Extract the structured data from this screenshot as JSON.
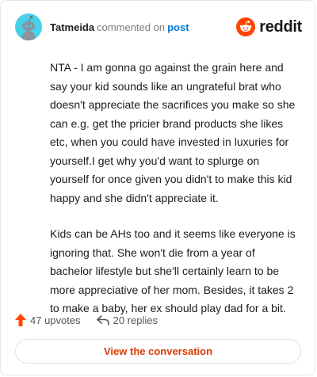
{
  "header": {
    "username": "Tatmeida",
    "action_text": "commented on",
    "target_text": "post",
    "logo_text": "reddit",
    "colors": {
      "avatar_bg": "#46d1e8",
      "logo_orange": "#ff4500",
      "link_blue": "#0079d3"
    }
  },
  "comment": {
    "paragraphs": [
      "NTA - I am gonna go against the grain here and say your kid sounds like an ungrateful brat who doesn't appreciate the sacrifices you make so she can e.g. get the pricier brand products she likes etc, when you could have invested in luxuries for yourself.I get why you'd want to splurge on yourself for once given you didn't to make this kid happy and she didn't appreciate it.",
      "Kids can be AHs too and it seems like everyone is ignoring that. She won't die from a year of bachelor lifestyle but she'll certainly learn to be more appreciative of her mom. Besides, it takes 2 to make a baby, her ex should play dad for a bit."
    ]
  },
  "stats": {
    "upvotes_label": "47 upvotes",
    "replies_label": "20 replies",
    "upvote_icon": "upvote-arrow-icon",
    "reply_icon": "reply-arrow-icon",
    "colors": {
      "upvote": "#ff4500"
    }
  },
  "footer": {
    "view_conversation_label": "View the conversation",
    "button_text_color": "#d93a00"
  }
}
